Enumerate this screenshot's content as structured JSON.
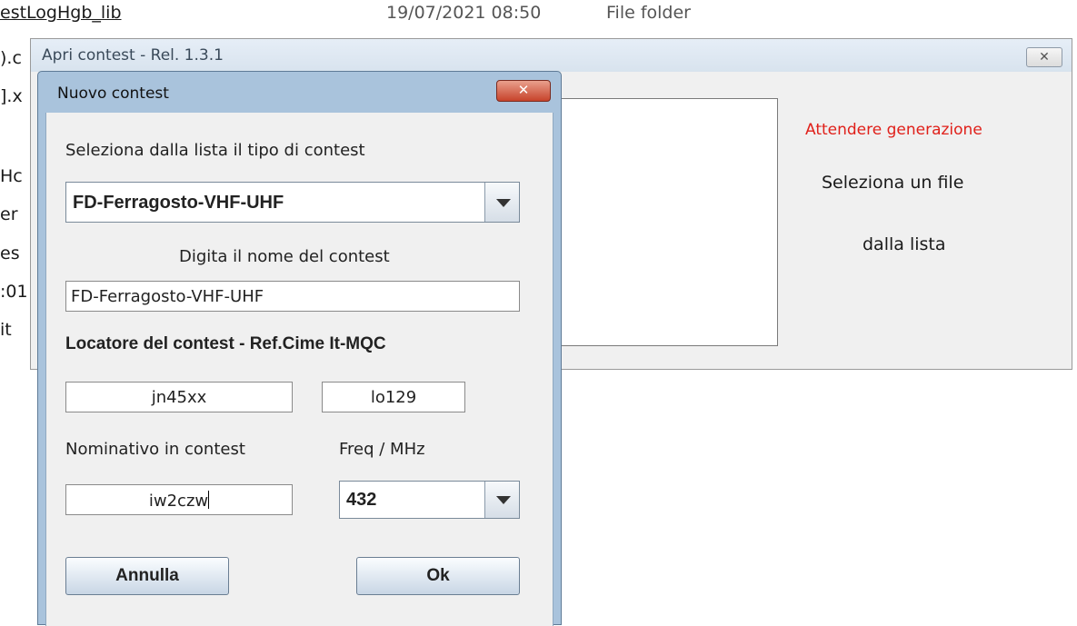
{
  "explorer": {
    "row": {
      "name": "estLogHgb_lib",
      "date": "19/07/2021 08:50",
      "type": "File folder"
    },
    "left_fragments": [
      ").c",
      "].x",
      "Hc",
      "er",
      "es",
      ":01",
      "it"
    ]
  },
  "outer_window": {
    "title": "Apri contest  - Rel. 1.3.1",
    "close_label": "✕",
    "status": "Attendere generazione",
    "hint_line1": "Seleziona un file",
    "hint_line2": "dalla lista"
  },
  "dialog": {
    "title": "Nuovo contest",
    "close_label": "✕",
    "select_label": "Seleziona dalla lista il tipo di contest",
    "contest_type_selected": "FD-Ferragosto-VHF-UHF",
    "name_label": "Digita il nome del contest",
    "name_value": "FD-Ferragosto-VHF-UHF",
    "locator_label": "Locatore del contest - Ref.Cime It-MQC",
    "locator_value": "jn45xx",
    "ref_value": "lo129",
    "callsign_label": "Nominativo in contest",
    "callsign_value": "iw2czw",
    "freq_label": "Freq / MHz",
    "freq_selected": "432",
    "cancel_label": "Annulla",
    "ok_label": "Ok"
  },
  "colors": {
    "dialog_frame": "#a9c3dc",
    "close_red": "#c7432b",
    "status_red": "#e0201a"
  }
}
